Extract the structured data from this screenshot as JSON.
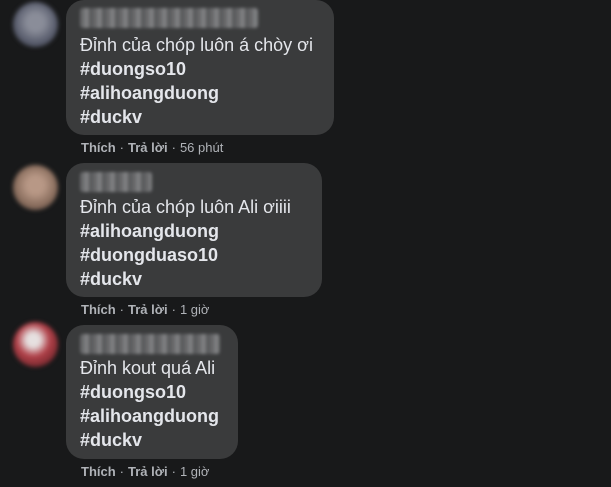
{
  "comments": [
    {
      "text_lines": [
        "Đỉnh của chóp luôn á chòy ơi",
        "#duongso10",
        "#alihoangduong",
        "#duckv"
      ],
      "like_label": "Thích",
      "reply_label": "Trả lời",
      "separator": "·",
      "time": "56 phút",
      "avatar_color": "#5a5e6e"
    },
    {
      "text_lines": [
        "Đỉnh của chóp luôn Ali ơiiii",
        "#alihoangduong",
        "#duongduaso10",
        "#duckv"
      ],
      "like_label": "Thích",
      "reply_label": "Trả lời",
      "separator": "·",
      "time": "1 giờ",
      "avatar_color": "#8a6e5e"
    },
    {
      "text_lines": [
        "Đỉnh kout quá Ali",
        "#duongso10",
        "#alihoangduong",
        "#duckv"
      ],
      "like_label": "Thích",
      "reply_label": "Trả lời",
      "separator": "·",
      "time": "1 giờ",
      "avatar_color": "#9a3a3e"
    }
  ]
}
